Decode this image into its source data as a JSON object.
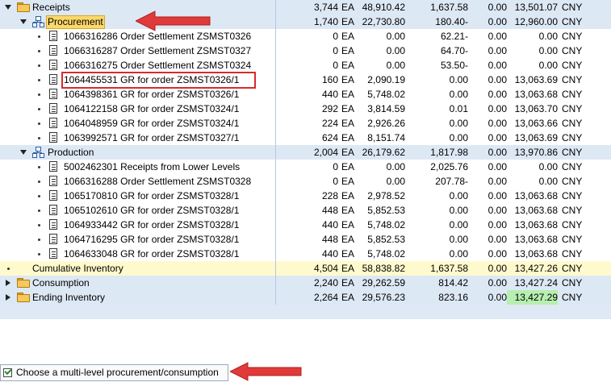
{
  "rows": [
    {
      "label": "Receipts",
      "qty": "3,744",
      "unit": "EA",
      "val": "48,910.42",
      "v2": "1,637.58",
      "v3": "0.00",
      "v4": "13,501.07",
      "cur": "CNY"
    },
    {
      "label": "Procurement",
      "qty": "1,740",
      "unit": "EA",
      "val": "22,730.80",
      "v2": "180.40-",
      "v3": "0.00",
      "v4": "12,960.00",
      "cur": "CNY"
    },
    {
      "label": "1066316286 Order Settlement ZSMST0326",
      "qty": "0",
      "unit": "EA",
      "val": "0.00",
      "v2": "62.21-",
      "v3": "0.00",
      "v4": "0.00",
      "cur": "CNY"
    },
    {
      "label": "1066316287 Order Settlement ZSMST0327",
      "qty": "0",
      "unit": "EA",
      "val": "0.00",
      "v2": "64.70-",
      "v3": "0.00",
      "v4": "0.00",
      "cur": "CNY"
    },
    {
      "label": "1066316275 Order Settlement ZSMST0324",
      "qty": "0",
      "unit": "EA",
      "val": "0.00",
      "v2": "53.50-",
      "v3": "0.00",
      "v4": "0.00",
      "cur": "CNY"
    },
    {
      "label": "1064455531 GR for order ZSMST0326/1",
      "qty": "160",
      "unit": "EA",
      "val": "2,090.19",
      "v2": "0.00",
      "v3": "0.00",
      "v4": "13,063.69",
      "cur": "CNY"
    },
    {
      "label": "1064398361 GR for order ZSMST0326/1",
      "qty": "440",
      "unit": "EA",
      "val": "5,748.02",
      "v2": "0.00",
      "v3": "0.00",
      "v4": "13,063.68",
      "cur": "CNY"
    },
    {
      "label": "1064122158 GR for order ZSMST0324/1",
      "qty": "292",
      "unit": "EA",
      "val": "3,814.59",
      "v2": "0.01",
      "v3": "0.00",
      "v4": "13,063.70",
      "cur": "CNY"
    },
    {
      "label": "1064048959 GR for order ZSMST0324/1",
      "qty": "224",
      "unit": "EA",
      "val": "2,926.26",
      "v2": "0.00",
      "v3": "0.00",
      "v4": "13,063.66",
      "cur": "CNY"
    },
    {
      "label": "1063992571 GR for order ZSMST0327/1",
      "qty": "624",
      "unit": "EA",
      "val": "8,151.74",
      "v2": "0.00",
      "v3": "0.00",
      "v4": "13,063.69",
      "cur": "CNY"
    },
    {
      "label": "Production",
      "qty": "2,004",
      "unit": "EA",
      "val": "26,179.62",
      "v2": "1,817.98",
      "v3": "0.00",
      "v4": "13,970.86",
      "cur": "CNY"
    },
    {
      "label": "5002462301 Receipts from Lower Levels",
      "qty": "0",
      "unit": "EA",
      "val": "0.00",
      "v2": "2,025.76",
      "v3": "0.00",
      "v4": "0.00",
      "cur": "CNY"
    },
    {
      "label": "1066316288 Order Settlement ZSMST0328",
      "qty": "0",
      "unit": "EA",
      "val": "0.00",
      "v2": "207.78-",
      "v3": "0.00",
      "v4": "0.00",
      "cur": "CNY"
    },
    {
      "label": "1065170810 GR for order ZSMST0328/1",
      "qty": "228",
      "unit": "EA",
      "val": "2,978.52",
      "v2": "0.00",
      "v3": "0.00",
      "v4": "13,063.68",
      "cur": "CNY"
    },
    {
      "label": "1065102610 GR for order ZSMST0328/1",
      "qty": "448",
      "unit": "EA",
      "val": "5,852.53",
      "v2": "0.00",
      "v3": "0.00",
      "v4": "13,063.68",
      "cur": "CNY"
    },
    {
      "label": "1064933442 GR for order ZSMST0328/1",
      "qty": "440",
      "unit": "EA",
      "val": "5,748.02",
      "v2": "0.00",
      "v3": "0.00",
      "v4": "13,063.68",
      "cur": "CNY"
    },
    {
      "label": "1064716295 GR for order ZSMST0328/1",
      "qty": "448",
      "unit": "EA",
      "val": "5,852.53",
      "v2": "0.00",
      "v3": "0.00",
      "v4": "13,063.68",
      "cur": "CNY"
    },
    {
      "label": "1064633048 GR for order ZSMST0328/1",
      "qty": "440",
      "unit": "EA",
      "val": "5,748.02",
      "v2": "0.00",
      "v3": "0.00",
      "v4": "13,063.68",
      "cur": "CNY"
    },
    {
      "label": "Cumulative Inventory",
      "qty": "4,504",
      "unit": "EA",
      "val": "58,838.82",
      "v2": "1,637.58",
      "v3": "0.00",
      "v4": "13,427.26",
      "cur": "CNY"
    },
    {
      "label": "Consumption",
      "qty": "2,240",
      "unit": "EA",
      "val": "29,262.59",
      "v2": "814.42",
      "v3": "0.00",
      "v4": "13,427.24",
      "cur": "CNY"
    },
    {
      "label": "Ending Inventory",
      "qty": "2,264",
      "unit": "EA",
      "val": "29,576.23",
      "v2": "823.16",
      "v3": "0.00",
      "v4": "13,427.29",
      "cur": "CNY"
    }
  ],
  "bottom": {
    "checkbox_label": "Choose a multi-level procurement/consumption",
    "checked": true
  },
  "icons": {
    "folder": "folder-icon",
    "network": "network-icon",
    "document": "document-icon"
  },
  "colors": {
    "highlight_yellow": "#fffacd",
    "green_cell": "#b6efb0",
    "annotation_red": "#d62c2c"
  }
}
